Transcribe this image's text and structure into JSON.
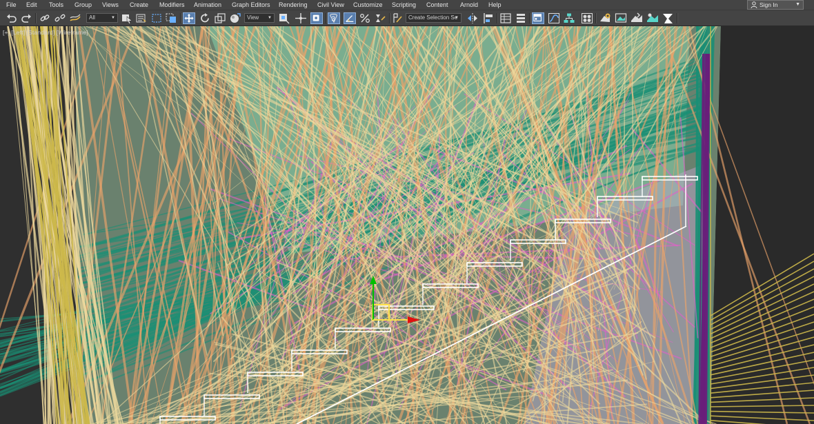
{
  "menubar": {
    "items": [
      "File",
      "Edit",
      "Tools",
      "Group",
      "Views",
      "Create",
      "Modifiers",
      "Animation",
      "Graph Editors",
      "Rendering",
      "Civil View",
      "Customize",
      "Scripting",
      "Content",
      "Arnold",
      "Help"
    ],
    "sign_in": "Sign In"
  },
  "toolbar": {
    "selection_filter": "All",
    "reference_coordinate": "View",
    "named_selection_placeholder": "Create Selection Se",
    "snap_toggle_label": "3"
  },
  "viewport": {
    "label_parts": [
      "[+]",
      "[Left]",
      "[Standard]",
      "[Wireframe]"
    ],
    "icons": [
      "undo-icon",
      "redo-icon",
      "link-icon",
      "unlink-icon",
      "bind-space-warp-icon",
      "select-object-icon",
      "select-by-name-icon",
      "rectangular-selection-icon",
      "window-crossing-icon",
      "select-and-move-icon",
      "select-and-rotate-icon",
      "select-and-scale-icon",
      "select-and-place-icon",
      "use-pivot-center-icon",
      "select-manipulate-icon",
      "keyboard-shortcut-override-icon",
      "snaps-toggle-icon",
      "angle-snap-icon",
      "percent-snap-icon",
      "spinner-snap-icon",
      "edit-named-selection-icon",
      "mirror-icon",
      "align-icon",
      "toggle-scene-explorer-icon",
      "toggle-layer-explorer-icon",
      "toggle-ribbon-icon",
      "curve-editor-icon",
      "schematic-view-icon",
      "material-editor-icon",
      "render-setup-icon",
      "rendered-frame-window-icon",
      "render-production-icon",
      "render-iterative-icon",
      "arnold-render-icon"
    ]
  },
  "colors": {
    "mint": "#8fe3b8",
    "teal": "#1a8f75",
    "peach": "#e9a36a",
    "sand": "#ecd89c",
    "magenta": "#e060c8",
    "purple": "#6a1f7a",
    "gold": "#cdb84a",
    "white": "#ffffff"
  }
}
